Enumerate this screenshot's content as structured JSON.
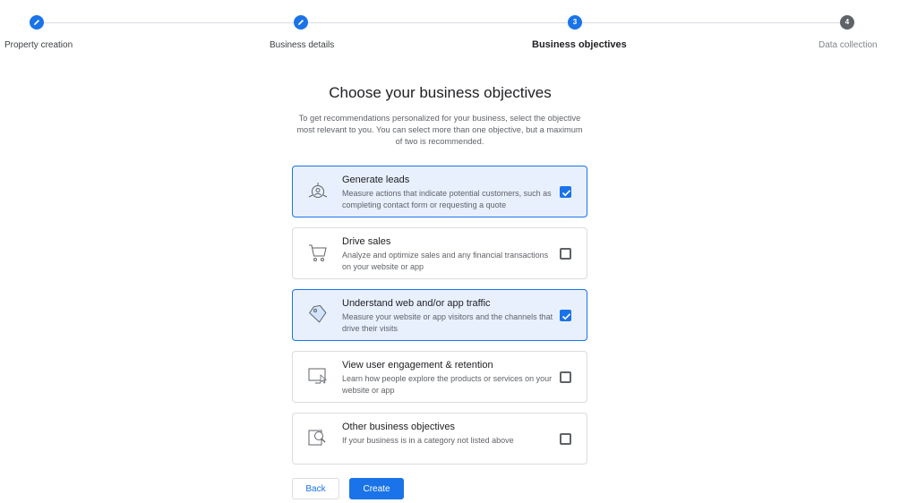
{
  "stepper": {
    "steps": [
      {
        "label": "Property creation",
        "state": "done",
        "icon": "pencil-icon"
      },
      {
        "label": "Business details",
        "state": "done",
        "icon": "pencil-icon"
      },
      {
        "label": "Business objectives",
        "state": "current",
        "number": "3"
      },
      {
        "label": "Data collection",
        "state": "todo",
        "number": "4"
      }
    ]
  },
  "page": {
    "title": "Choose your business objectives",
    "subtitle": "To get recommendations personalized for your business, select the objective most relevant to you. You can select more than one objective, but a maximum of two is recommended."
  },
  "options": [
    {
      "title": "Generate leads",
      "description": "Measure actions that indicate potential customers, such as completing contact form or requesting a quote",
      "checked": true,
      "icon": "leads-target-icon"
    },
    {
      "title": "Drive sales",
      "description": "Analyze and optimize sales and any financial transactions on your website or app",
      "checked": false,
      "icon": "shopping-cart-icon"
    },
    {
      "title": "Understand web and/or app traffic",
      "description": "Measure your website or app visitors and the channels that drive their visits",
      "checked": true,
      "icon": "tag-icon"
    },
    {
      "title": "View user engagement & retention",
      "description": "Learn how people explore the products or services on your website or app",
      "checked": false,
      "icon": "monitor-cursor-icon"
    },
    {
      "title": "Other business objectives",
      "description": "If your business is in a category not listed above",
      "checked": false,
      "icon": "magnifier-icon"
    }
  ],
  "actions": {
    "back_label": "Back",
    "create_label": "Create"
  },
  "colors": {
    "accent": "#1a73e8",
    "selected_bg": "#e8f0fe",
    "border": "#dadce0",
    "muted": "#5f6368"
  }
}
